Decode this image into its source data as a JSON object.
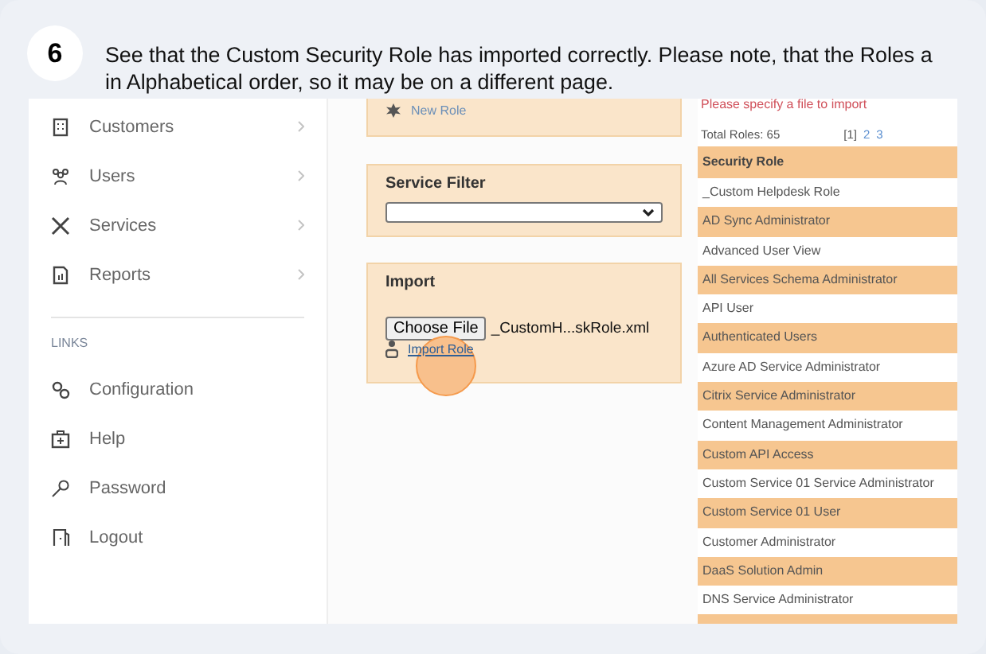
{
  "step": {
    "number": "6",
    "instruction_lines": [
      "See that the Custom Security Role has imported correctly. Please note, that the Roles a",
      "in Alphabetical order, so it may be on a different page."
    ]
  },
  "sidebar": {
    "items": [
      {
        "label": "Customers"
      },
      {
        "label": "Users"
      },
      {
        "label": "Services"
      },
      {
        "label": "Reports"
      }
    ],
    "links_heading": "LINKS",
    "links": [
      {
        "label": "Configuration"
      },
      {
        "label": "Help"
      },
      {
        "label": "Password"
      },
      {
        "label": "Logout"
      }
    ]
  },
  "new_role": {
    "link": "New Role"
  },
  "service_filter": {
    "title": "Service Filter"
  },
  "import": {
    "title": "Import",
    "choose_button": "Choose File",
    "file_name": "_CustomH...skRole.xml",
    "link": "Import Role"
  },
  "roles": {
    "error": "Please specify a file to import",
    "total": "Total Roles:  65",
    "pages": [
      {
        "label": "[1]",
        "selected": true
      },
      {
        "label": "2",
        "selected": false
      },
      {
        "label": "3",
        "selected": false
      }
    ],
    "header": "Security Role",
    "rows": [
      "_Custom Helpdesk Role",
      "AD Sync Administrator",
      "Advanced User View",
      "All Services Schema Administrator",
      "API User",
      "Authenticated Users",
      "Azure AD Service Administrator",
      "Citrix Service Administrator",
      "Content Management Administrator",
      "Custom API Access",
      "Custom Service 01 Service Administrator",
      "Custom Service 01 User",
      "Customer Administrator",
      "DaaS Solution Admin",
      "DNS Service Administrator"
    ]
  }
}
